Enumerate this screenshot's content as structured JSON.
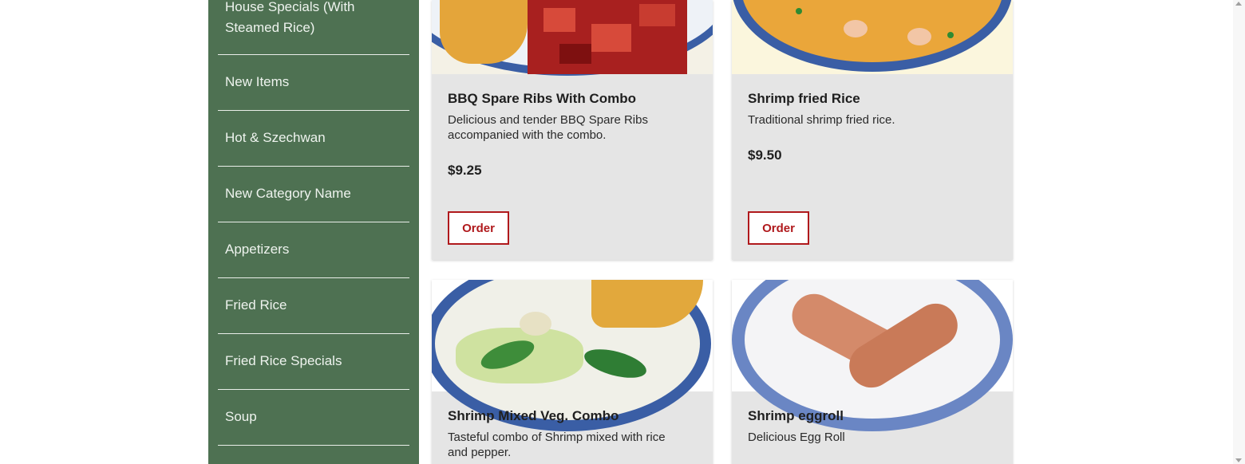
{
  "sidebar": {
    "items": [
      {
        "label": "House Specials (With Steamed Rice)"
      },
      {
        "label": "New Items"
      },
      {
        "label": "Hot & Szechwan"
      },
      {
        "label": "New Category Name"
      },
      {
        "label": "Appetizers"
      },
      {
        "label": "Fried Rice"
      },
      {
        "label": "Fried Rice Specials"
      },
      {
        "label": "Soup"
      }
    ]
  },
  "menu": {
    "items": [
      {
        "name": "BBQ Spare Ribs With Combo",
        "description": "Delicious and tender BBQ Spare Ribs accompanied with the combo.",
        "price": "$9.25",
        "order_label": "Order",
        "image_icon": "spare-ribs-photo"
      },
      {
        "name": "Shrimp fried Rice",
        "description": "Traditional shrimp fried rice.",
        "price": "$9.50",
        "order_label": "Order",
        "image_icon": "shrimp-fried-rice-photo"
      },
      {
        "name": "Shrimp Mixed Veg. Combo",
        "description": "Tasteful combo of Shrimp mixed with rice and pepper.",
        "image_icon": "shrimp-mixed-veg-photo"
      },
      {
        "name": "Shrimp eggroll",
        "description": "Delicious Egg Roll",
        "image_icon": "egg-roll-photo"
      }
    ]
  },
  "colors": {
    "sidebar_bg": "#4e7152",
    "card_bg": "#e5e5e5",
    "order_accent": "#b0191c"
  }
}
